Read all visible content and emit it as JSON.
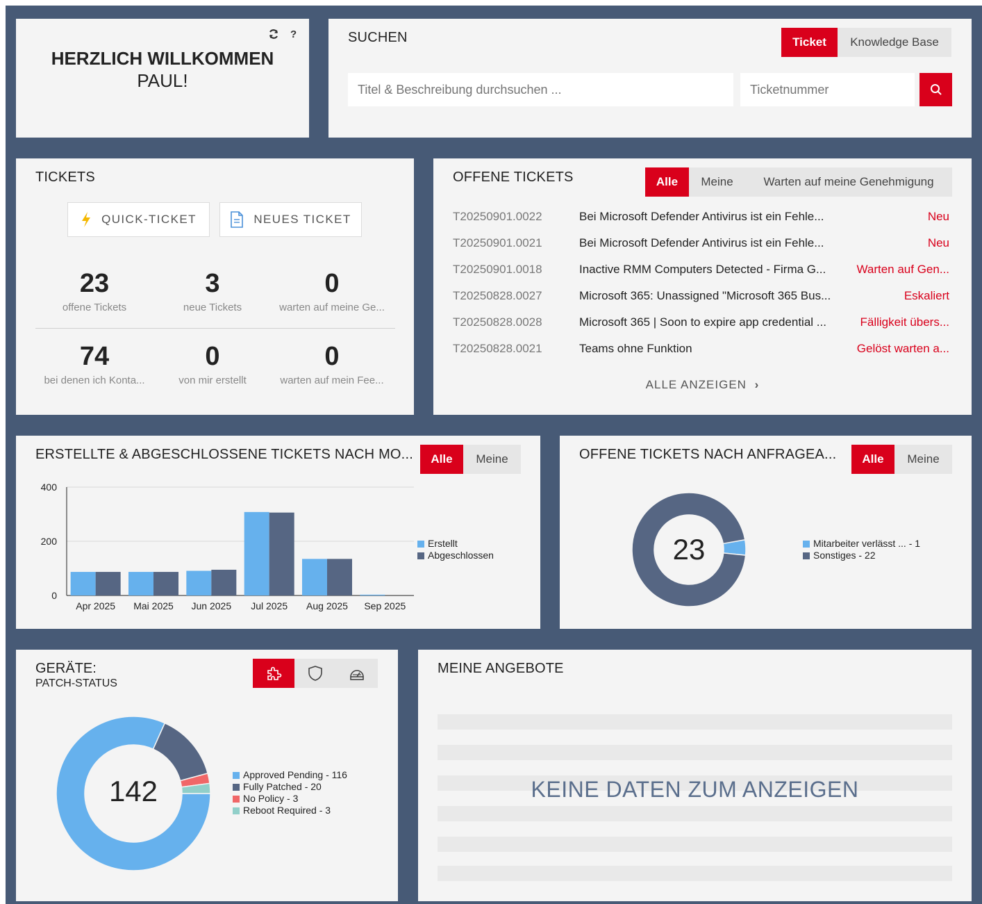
{
  "welcome": {
    "line1": "HERZLICH WILLKOMMEN",
    "line2": "PAUL!",
    "refresh_icon": "refresh-icon",
    "help_label": "?"
  },
  "search": {
    "title": "SUCHEN",
    "tabs": [
      {
        "label": "Ticket",
        "active": true
      },
      {
        "label": "Knowledge Base",
        "active": false
      }
    ],
    "text_placeholder": "Titel & Beschreibung durchsuchen ...",
    "number_placeholder": "Ticketnummer",
    "button_icon": "search-icon"
  },
  "tickets": {
    "title": "TICKETS",
    "quick_label": "QUICK-TICKET",
    "new_label": "NEUES TICKET",
    "stats": [
      {
        "value": "23",
        "label": "offene Tickets"
      },
      {
        "value": "3",
        "label": "neue Tickets"
      },
      {
        "value": "0",
        "label": "warten auf meine Ge..."
      },
      {
        "value": "74",
        "label": "bei denen ich Konta..."
      },
      {
        "value": "0",
        "label": "von mir erstellt"
      },
      {
        "value": "0",
        "label": "warten auf mein Fee..."
      }
    ]
  },
  "open_tickets": {
    "title": "OFFENE TICKETS",
    "tabs": [
      {
        "label": "Alle",
        "active": true
      },
      {
        "label": "Meine",
        "active": false
      },
      {
        "label": "Warten auf meine Genehmigung",
        "active": false
      }
    ],
    "rows": [
      {
        "id": "T20250901.0022",
        "subject": "Bei Microsoft Defender Antivirus ist ein Fehle...",
        "status": "Neu"
      },
      {
        "id": "T20250901.0021",
        "subject": "Bei Microsoft Defender Antivirus ist ein Fehle...",
        "status": "Neu"
      },
      {
        "id": "T20250901.0018",
        "subject": "Inactive RMM Computers Detected - Firma G...",
        "status": "Warten auf Gen..."
      },
      {
        "id": "T20250828.0027",
        "subject": "Microsoft 365: Unassigned \"Microsoft 365 Bus...",
        "status": "Eskaliert"
      },
      {
        "id": "T20250828.0028",
        "subject": "Microsoft 365 | Soon to expire app credential ...",
        "status": "Fälligkeit übers..."
      },
      {
        "id": "T20250828.0021",
        "subject": "Teams ohne Funktion",
        "status": "Gelöst warten a..."
      }
    ],
    "show_all": "ALLE ANZEIGEN"
  },
  "created_closed": {
    "title": "ERSTELLTE & ABGESCHLOSSENE TICKETS NACH MO...",
    "tabs": [
      {
        "label": "Alle",
        "active": true
      },
      {
        "label": "Meine",
        "active": false
      }
    ]
  },
  "by_request": {
    "title": "OFFENE TICKETS NACH ANFRAGEA...",
    "tabs": [
      {
        "label": "Alle",
        "active": true
      },
      {
        "label": "Meine",
        "active": false
      }
    ],
    "center": "23"
  },
  "devices": {
    "title": "GERÄTE:",
    "subtitle": "PATCH-STATUS",
    "icons": [
      {
        "name": "puzzle-icon",
        "active": true
      },
      {
        "name": "shield-icon",
        "active": false
      },
      {
        "name": "gauge-icon",
        "active": false
      }
    ],
    "center": "142"
  },
  "offers": {
    "title": "MEINE ANGEBOTE",
    "empty": "KEINE DATEN ZUM ANZEIGEN"
  },
  "colors": {
    "accent": "#d9001b",
    "frame": "#475a76",
    "series_light": "#66b1ed",
    "series_dark": "#566683",
    "red": "#f06768",
    "teal": "#91cfc9"
  },
  "chart_data": [
    {
      "type": "bar",
      "categories": [
        "Apr 2025",
        "Mai 2025",
        "Jun 2025",
        "Jul 2025",
        "Aug 2025",
        "Sep 2025"
      ],
      "series": [
        {
          "name": "Erstellt",
          "values": [
            87,
            87,
            91,
            308,
            135,
            3
          ]
        },
        {
          "name": "Abgeschlossen",
          "values": [
            87,
            87,
            95,
            306,
            135,
            0
          ]
        }
      ],
      "ylim": [
        0,
        400
      ],
      "yticks": [
        0,
        200,
        400
      ],
      "legend": "right"
    },
    {
      "type": "pie",
      "labels": [
        "Mitarbeiter verlässt ... - 1",
        "Sonstiges - 22"
      ],
      "values": [
        1,
        22
      ],
      "center": "23",
      "legend": "right"
    },
    {
      "type": "pie",
      "labels": [
        "Approved Pending - 116",
        "Fully Patched - 20",
        "No Policy - 3",
        "Reboot Required - 3"
      ],
      "values": [
        116,
        20,
        3,
        3
      ],
      "center": "142",
      "legend": "right"
    }
  ]
}
